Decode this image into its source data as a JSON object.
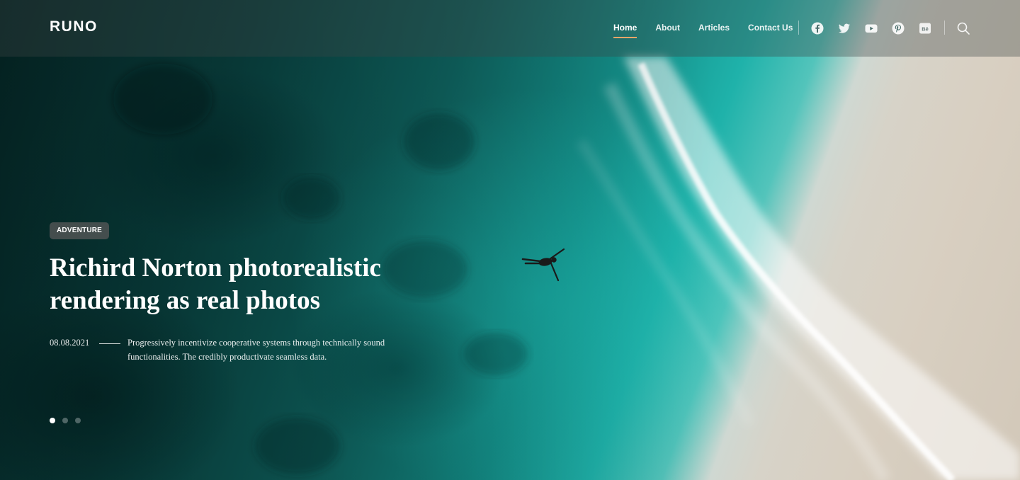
{
  "header": {
    "logo": "RUNO",
    "nav": [
      {
        "label": "Home",
        "active": true
      },
      {
        "label": "About",
        "active": false
      },
      {
        "label": "Articles",
        "active": false
      },
      {
        "label": "Contact Us",
        "active": false
      }
    ],
    "social_icons": [
      "facebook-icon",
      "twitter-icon",
      "youtube-icon",
      "pinterest-icon",
      "behance-icon"
    ],
    "search_icon": "search-icon"
  },
  "hero": {
    "tag": "ADVENTURE",
    "title": "Richird Norton photorealistic rendering as real photos",
    "date": "08.08.2021",
    "excerpt": "Progressively incentivize cooperative systems through technically sound functionalities. The credibly productivate seamless data.",
    "slides": {
      "count": 3,
      "active_index": 0
    }
  },
  "colors": {
    "accent": "#e8a668",
    "header_bg": "rgba(60,70,70,0.35)",
    "tag_bg": "#5a5a5a",
    "text": "#ffffff"
  }
}
